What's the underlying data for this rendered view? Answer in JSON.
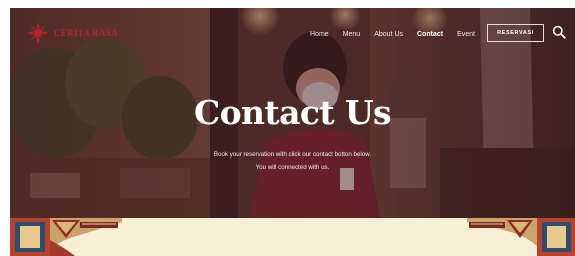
{
  "brand": {
    "name": "CERITA RASA"
  },
  "nav": {
    "items": [
      {
        "label": "Home"
      },
      {
        "label": "Menu"
      },
      {
        "label": "About Us"
      },
      {
        "label": "Contact"
      },
      {
        "label": "Event"
      }
    ],
    "reserve_label": "RESERVASI",
    "search_icon": "search-icon"
  },
  "hero": {
    "title": "Contact Us",
    "subtitle_line1": "Book your reservation with click our contact botton below.",
    "subtitle_line2": "You will connected with us."
  },
  "colors": {
    "brand_red": "#b3242b",
    "hero_tint": "#4a2a2b",
    "band_cream": "#f7efd6"
  }
}
